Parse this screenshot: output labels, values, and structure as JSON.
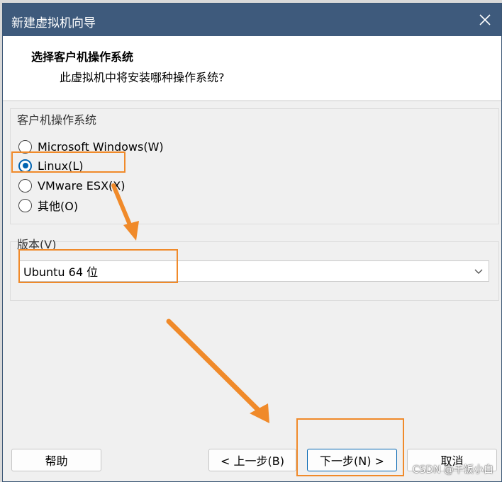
{
  "window": {
    "title": "新建虚拟机向导"
  },
  "header": {
    "title": "选择客户机操作系统",
    "subtitle": "此虚拟机中将安装哪种操作系统?"
  },
  "guest_os": {
    "label": "客户机操作系统",
    "options": [
      {
        "label": "Microsoft Windows(W)",
        "checked": false
      },
      {
        "label": "Linux(L)",
        "checked": true
      },
      {
        "label": "VMware ESX(X)",
        "checked": false
      },
      {
        "label": "其他(O)",
        "checked": false
      }
    ]
  },
  "version": {
    "label": "版本(V)",
    "value": "Ubuntu 64 位"
  },
  "buttons": {
    "help": "帮助",
    "back": "< 上一步(B)",
    "next": "下一步(N) >",
    "cancel": "取消"
  },
  "watermark": "CSDN @干饭小白",
  "colors": {
    "titlebar": "#3e5a7c",
    "accent": "#0063b1",
    "annotation": "#f08a2a"
  }
}
